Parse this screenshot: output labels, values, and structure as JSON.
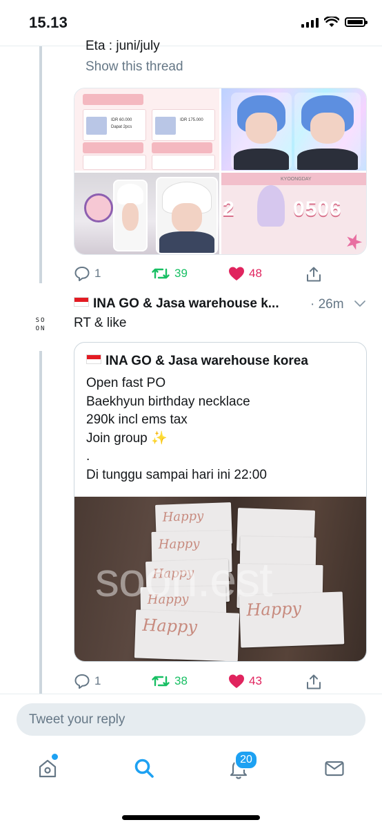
{
  "status_bar": {
    "time": "15.13"
  },
  "prev_tweet": {
    "partial_text": "Eta : juni/july",
    "show_thread": "Show this thread",
    "image_texts": {
      "price_1": "IDR 60.000",
      "price_2": "IDR 175.000",
      "dapat": "Dapat 2pcs",
      "banner": "0506",
      "banner_prefix": "2",
      "kyoong": "KYOONGDAY"
    },
    "actions": {
      "replies": "1",
      "retweets": "39",
      "likes": "48"
    }
  },
  "tweet": {
    "author": "INA GO & Jasa warehouse k...",
    "time": "· 26m",
    "avatar_line1": "SO",
    "avatar_line2": "ON",
    "text": "RT & like",
    "quote": {
      "author": "INA GO & Jasa warehouse korea",
      "lines": [
        "Open fast PO",
        "Baekhyun birthday necklace",
        "290k incl ems tax",
        "Join group ✨",
        ".",
        "Di tunggu sampai hari ini 22:00"
      ],
      "watermark": "soon.est",
      "card_text": "Happy"
    },
    "actions": {
      "replies": "1",
      "retweets": "38",
      "likes": "43"
    }
  },
  "reply_bar": {
    "placeholder": "Tweet your reply"
  },
  "tabbar": {
    "notifications_badge": "20"
  },
  "colors": {
    "blue": "#1da1f2",
    "green": "#17bf63",
    "red": "#e0245e",
    "gray": "#657786"
  }
}
